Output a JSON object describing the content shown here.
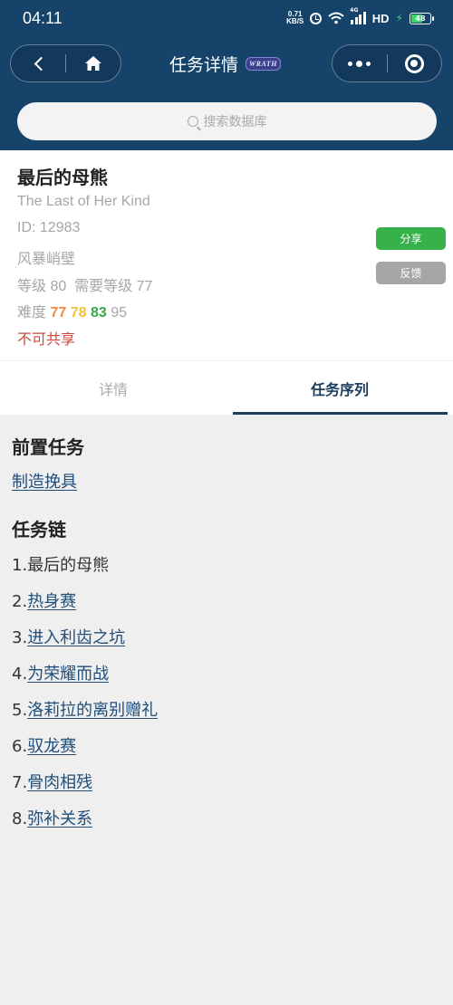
{
  "status_bar": {
    "time": "04:11",
    "net_speed_value": "0.71",
    "net_speed_unit": "KB/S",
    "signal_label": "4G",
    "hd_label": "HD",
    "battery": "48"
  },
  "nav": {
    "title": "任务详情",
    "expansion_badge": "WRATH",
    "back_icon": "chevron-left-icon",
    "home_icon": "home-icon",
    "more_icon": "more-dots-icon",
    "close_icon": "target-circle-icon"
  },
  "search": {
    "placeholder": "搜索数据库"
  },
  "quest": {
    "name_cn": "最后的母熊",
    "name_en": "The Last of Her Kind",
    "id_label": "ID: 12983",
    "zone": "风暴峭壁",
    "level_label": "等级 80",
    "required_level_label": "需要等级 77",
    "difficulty_label": "难度",
    "difficulty": [
      "77",
      "78",
      "83",
      "95"
    ],
    "difficulty_colors": [
      "#f08a3c",
      "#f2c232",
      "#3aa84b",
      "#a6a6a6"
    ],
    "shareable": "不可共享"
  },
  "actions": {
    "share": "分享",
    "feedback": "反馈",
    "share_color": "#37b24a",
    "feedback_color": "#a6a6a6"
  },
  "tabs": [
    {
      "label": "详情",
      "active": false
    },
    {
      "label": "任务序列",
      "active": true
    }
  ],
  "prerequisite": {
    "title": "前置任务",
    "items": [
      "制造挽具"
    ]
  },
  "chain": {
    "title": "任务链",
    "items": [
      {
        "num": "1.",
        "label": "最后的母熊",
        "link": false
      },
      {
        "num": "2.",
        "label": "热身赛",
        "link": true
      },
      {
        "num": "3.",
        "label": "进入利齿之坑",
        "link": true
      },
      {
        "num": "4.",
        "label": "为荣耀而战",
        "link": true
      },
      {
        "num": "5.",
        "label": "洛莉拉的离别赠礼",
        "link": true
      },
      {
        "num": "6.",
        "label": "驭龙赛",
        "link": true
      },
      {
        "num": "7.",
        "label": "骨肉相残",
        "link": true
      },
      {
        "num": "8.",
        "label": "弥补关系",
        "link": true
      }
    ]
  },
  "colors": {
    "header_bg": "#16436a",
    "accent": "#1b3d5e",
    "link": "#1f4e7a",
    "warning": "#c94a3c"
  }
}
